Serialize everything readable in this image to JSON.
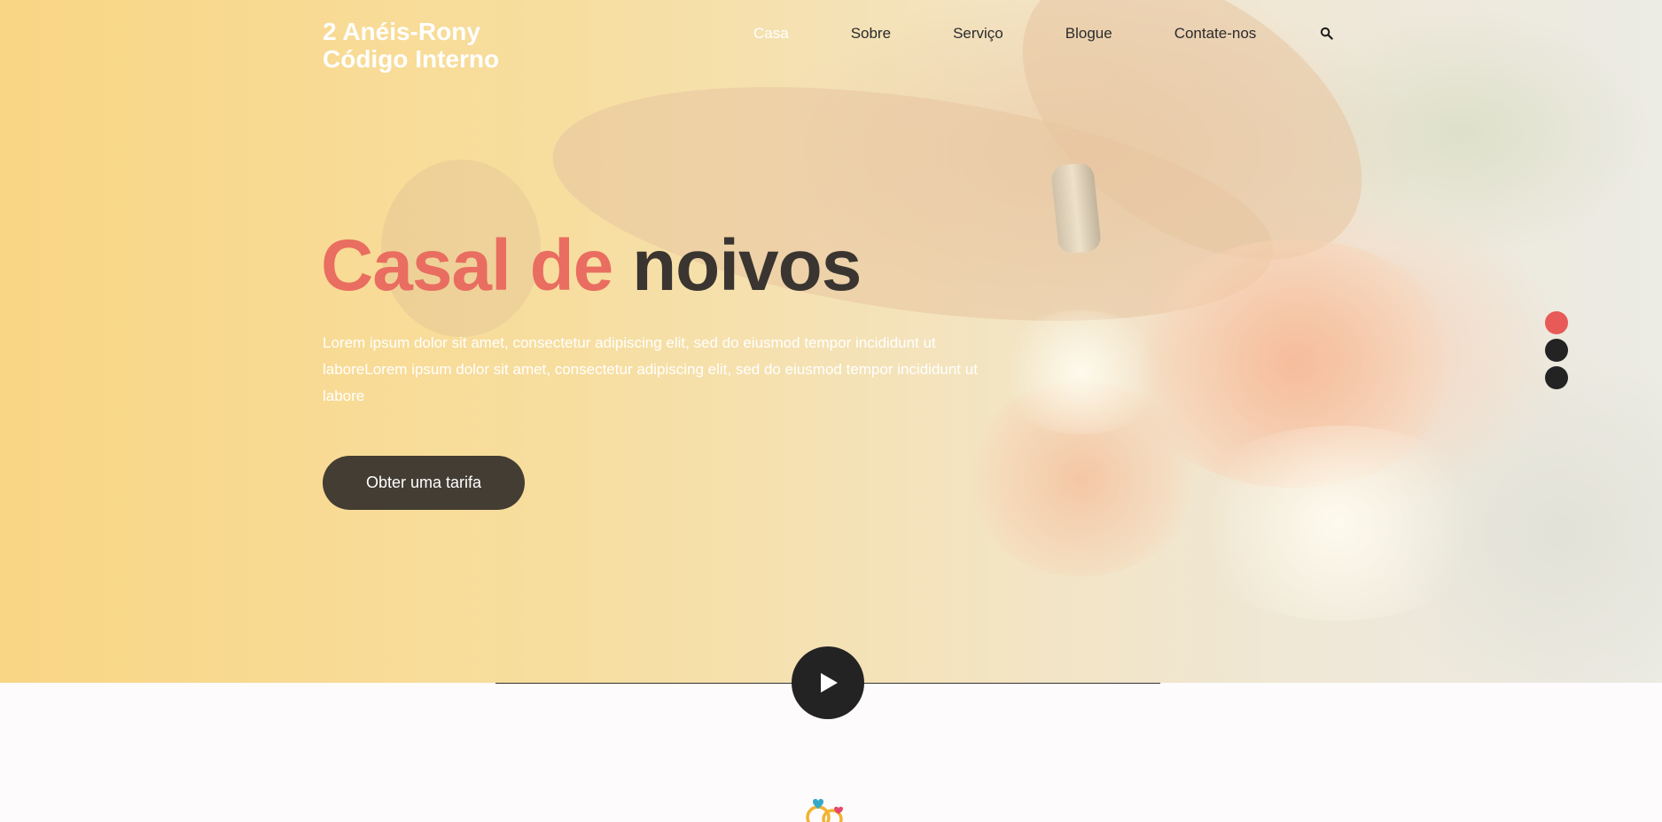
{
  "header": {
    "logo_line1": "2 Anéis-Rony",
    "logo_line2": "Código Interno",
    "nav": [
      {
        "label": "Casa",
        "active": true
      },
      {
        "label": "Sobre"
      },
      {
        "label": "Serviço"
      },
      {
        "label": "Blogue"
      },
      {
        "label": "Contate-nos"
      }
    ],
    "search_icon": "search-icon"
  },
  "hero": {
    "title_accent": "Casal de",
    "title_dark": "noivos",
    "description": "Lorem ipsum dolor sit amet, consectetur adipiscing elit, sed do eiusmod tempor incididunt ut laboreLorem ipsum dolor sit amet, consectetur adipiscing elit, sed do eiusmod tempor incididunt ut labore",
    "cta_label": "Obter uma tarifa",
    "slides": 3,
    "active_slide": 1
  },
  "video": {
    "play_icon": "play-icon"
  },
  "colors": {
    "accent": "#e96d60",
    "dark": "#3a3530",
    "button": "#433d33",
    "dot_active": "#e75a58",
    "dot": "#232323"
  },
  "icons": {
    "rings": "wedding-rings-icon"
  }
}
